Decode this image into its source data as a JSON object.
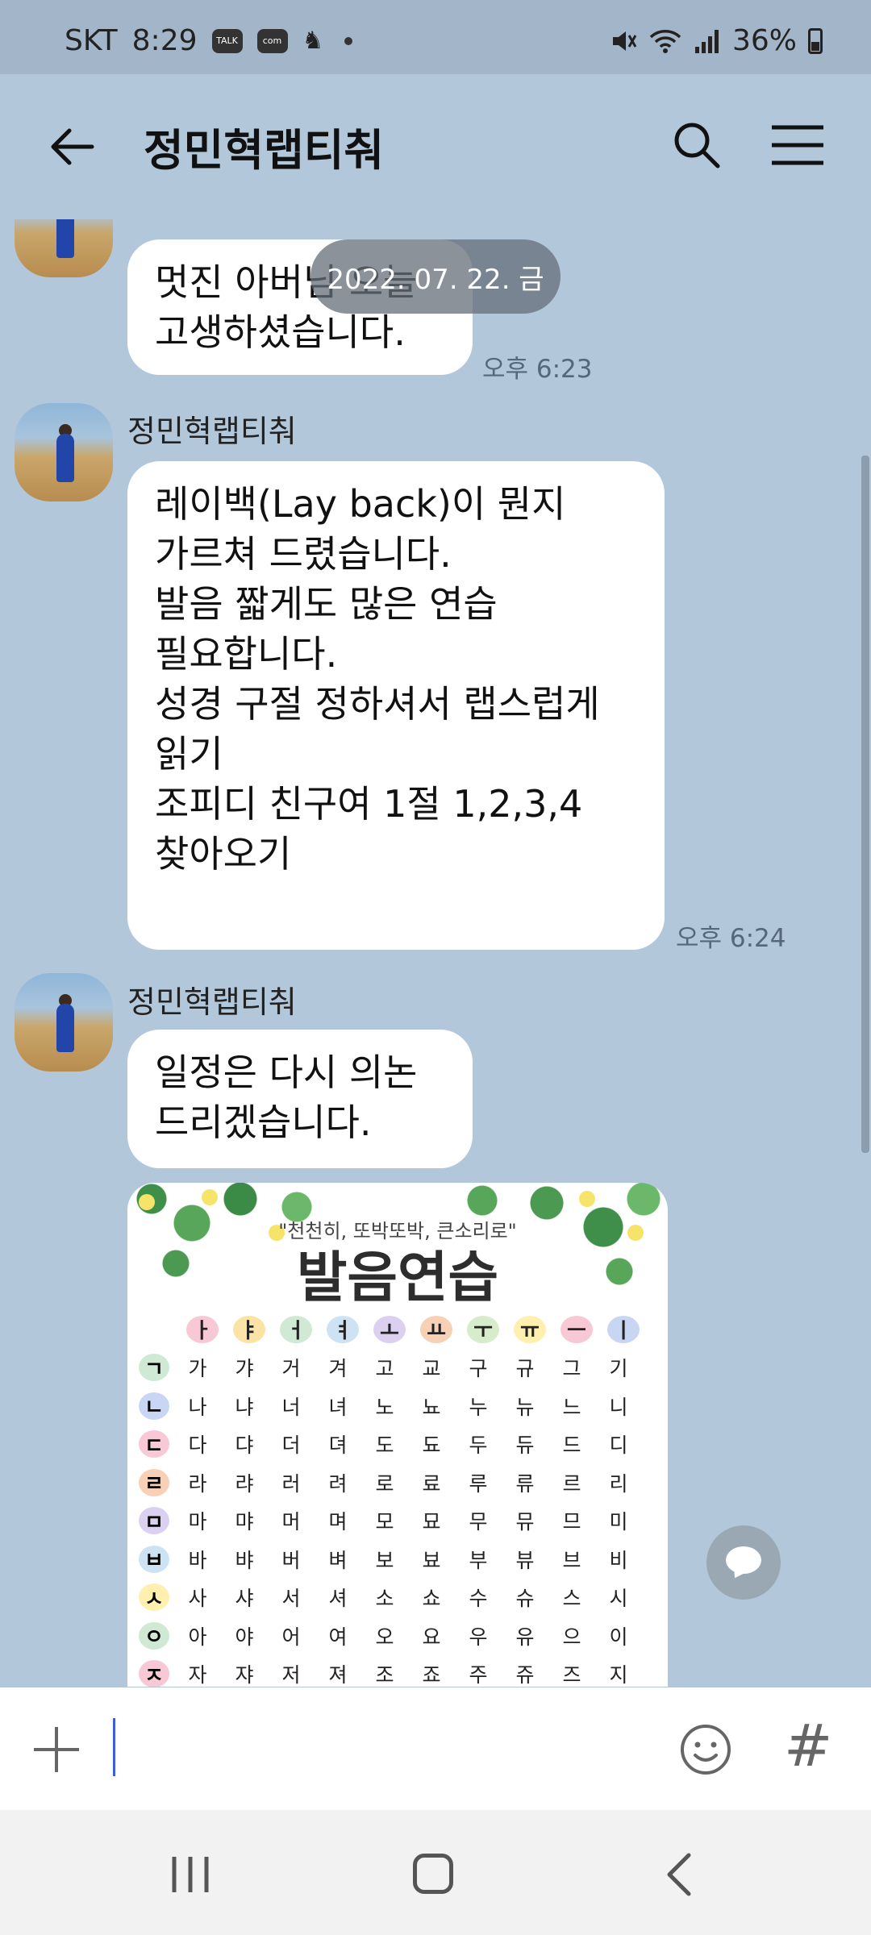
{
  "status_bar": {
    "carrier": "SKT",
    "time": "8:29",
    "badge_talk": "TALK",
    "badge_com": "com",
    "battery": "36%"
  },
  "header": {
    "title": "정민혁랩티춰",
    "back_icon": "arrow-left-icon",
    "search_icon": "search-icon",
    "menu_icon": "hamburger-menu-icon"
  },
  "chat": {
    "date_divider": "2022. 07. 22. 금",
    "messages": [
      {
        "text": "멋진 아버님 오늘\n고생하셨습니다.",
        "time": "오후 6:23"
      },
      {
        "sender": "정민혁랩티춰",
        "text": "레이백(Lay back)이 뭔지\n가르쳐 드렸습니다.\n발음 짧게도 많은 연습\n필요합니다.\n성경 구절 정하셔서 랩스럽게\n읽기\n조피디 친구여 1절 1,2,3,4\n찾아오기\n",
        "time": "오후 6:24"
      },
      {
        "sender": "정민혁랩티춰",
        "text": "일정은 다시 의논\n드리겠습니다."
      }
    ],
    "image_card": {
      "subtitle": "\"천천히, 또박또박, 큰소리로\"",
      "title": "발음연습",
      "vowels": [
        "ㅏ",
        "ㅑ",
        "ㅓ",
        "ㅕ",
        "ㅗ",
        "ㅛ",
        "ㅜ",
        "ㅠ",
        "ㅡ",
        "ㅣ"
      ],
      "rows": [
        {
          "consonant": "ㄱ",
          "syllables": [
            "가",
            "갸",
            "거",
            "겨",
            "고",
            "교",
            "구",
            "규",
            "그",
            "기"
          ]
        },
        {
          "consonant": "ㄴ",
          "syllables": [
            "나",
            "냐",
            "너",
            "녀",
            "노",
            "뇨",
            "누",
            "뉴",
            "느",
            "니"
          ]
        },
        {
          "consonant": "ㄷ",
          "syllables": [
            "다",
            "댜",
            "더",
            "뎌",
            "도",
            "됴",
            "두",
            "듀",
            "드",
            "디"
          ]
        },
        {
          "consonant": "ㄹ",
          "syllables": [
            "라",
            "랴",
            "러",
            "려",
            "로",
            "료",
            "루",
            "류",
            "르",
            "리"
          ]
        },
        {
          "consonant": "ㅁ",
          "syllables": [
            "마",
            "먀",
            "머",
            "며",
            "모",
            "묘",
            "무",
            "뮤",
            "므",
            "미"
          ]
        },
        {
          "consonant": "ㅂ",
          "syllables": [
            "바",
            "뱌",
            "버",
            "벼",
            "보",
            "뵤",
            "부",
            "뷰",
            "브",
            "비"
          ]
        },
        {
          "consonant": "ㅅ",
          "syllables": [
            "사",
            "샤",
            "서",
            "셔",
            "소",
            "쇼",
            "수",
            "슈",
            "스",
            "시"
          ]
        },
        {
          "consonant": "ㅇ",
          "syllables": [
            "아",
            "야",
            "어",
            "여",
            "오",
            "요",
            "우",
            "유",
            "으",
            "이"
          ]
        },
        {
          "consonant": "ㅈ",
          "syllables": [
            "자",
            "쟈",
            "저",
            "져",
            "조",
            "죠",
            "주",
            "쥬",
            "즈",
            "지"
          ]
        }
      ]
    }
  },
  "input": {
    "value": "",
    "plus_icon": "plus-icon",
    "emoji_icon": "emoji-icon",
    "hash_label": "#"
  },
  "nav": {
    "recent_icon": "recent-apps-icon",
    "home_icon": "home-icon",
    "back_icon": "back-icon"
  },
  "colors": {
    "background": "#b2c7da",
    "status_bar": "#a3b6c9",
    "bubble": "#ffffff",
    "caret": "#3b5ee0"
  }
}
